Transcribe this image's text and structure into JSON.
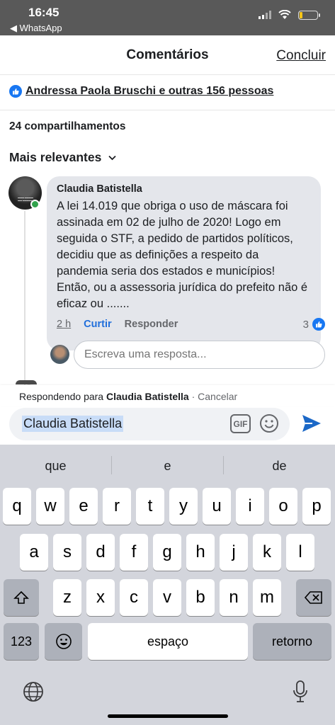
{
  "status": {
    "time": "16:45",
    "back_label": "◀ WhatsApp"
  },
  "header": {
    "title": "Comentários",
    "done_label": "Concluir"
  },
  "reactions": {
    "likes_text": "Andressa Paola Bruschi e outras 156 pessoas"
  },
  "shares_text": "24 compartilhamentos",
  "sort_label": "Mais relevantes",
  "comment": {
    "author": "Claudia Batistella",
    "text": "A lei 14.019 que obriga o uso de máscara foi assinada em 02 de julho de 2020! Logo em seguida o STF, a pedido de partidos políticos, decidiu que as definições a respeito da pandemia seria dos estados e municípios! Então, ou a assessoria jurídica do prefeito não é eficaz ou .......",
    "time": "2 h",
    "like_label": "Curtir",
    "reply_label": "Responder",
    "like_count": "3"
  },
  "reply_input": {
    "placeholder": "Escreva uma resposta..."
  },
  "replying": {
    "prefix": "Respondendo para",
    "name": "Claudia Batistella",
    "separator": "·",
    "cancel_label": "Cancelar"
  },
  "composer": {
    "value": "Claudia Batistella",
    "gif_label": "GIF"
  },
  "keyboard": {
    "suggestions": [
      "que",
      "e",
      "de"
    ],
    "row1": [
      "q",
      "w",
      "e",
      "r",
      "t",
      "y",
      "u",
      "i",
      "o",
      "p"
    ],
    "row2": [
      "a",
      "s",
      "d",
      "f",
      "g",
      "h",
      "j",
      "k",
      "l"
    ],
    "row3": [
      "z",
      "x",
      "c",
      "v",
      "b",
      "n",
      "m"
    ],
    "numbers_label": "123",
    "space_label": "espaço",
    "return_label": "retorno"
  },
  "colors": {
    "accent": "#1877f2",
    "online": "#31a24c",
    "bubble": "#e4e6eb",
    "keyboard_bg": "#d3d5dc"
  }
}
